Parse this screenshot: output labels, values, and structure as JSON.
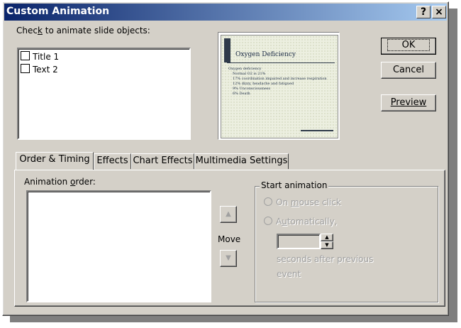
{
  "window": {
    "title": "Custom Animation",
    "help_btn": "?",
    "close_btn": "×"
  },
  "objects": {
    "label": "Check to animate slide objects:",
    "items": [
      {
        "label": "Title 1",
        "checked": false
      },
      {
        "label": "Text 2",
        "checked": false
      }
    ]
  },
  "slide_preview": {
    "title": "Oxygen Deficiency",
    "bullet_main": "Oxygen deficiency",
    "sub_bullets": [
      "Normal O2 is 21%",
      "17% coordination impaired and increase respiration",
      "12% dizzy, headache and fatigued",
      "9% Unconsciousness",
      "6% Death"
    ]
  },
  "buttons": {
    "ok": "OK",
    "cancel": "Cancel",
    "preview": "Preview"
  },
  "tabs": [
    {
      "label": "Order & Timing",
      "active": true
    },
    {
      "label": "Effects",
      "active": false
    },
    {
      "label": "Chart Effects",
      "active": false
    },
    {
      "label": "Multimedia Settings",
      "active": false
    }
  ],
  "order": {
    "label": "Animation order:",
    "move_label": "Move"
  },
  "start": {
    "group_label": "Start animation",
    "on_mouse_click": "On mouse click",
    "automatically": "Automatically,",
    "seconds_value": "",
    "seconds_line1": "seconds after previous",
    "seconds_line2": "event"
  }
}
